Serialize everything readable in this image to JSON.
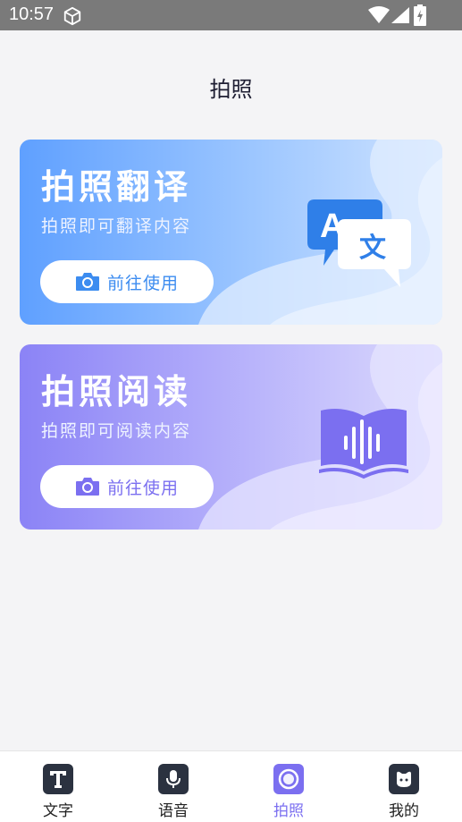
{
  "status_bar": {
    "time": "10:57"
  },
  "page": {
    "title": "拍照"
  },
  "cards": [
    {
      "title": "拍照翻译",
      "subtitle": "拍照即可翻译内容",
      "button_label": "前往使用",
      "art_glyph_a": "A",
      "art_glyph_b": "文"
    },
    {
      "title": "拍照阅读",
      "subtitle": "拍照即可阅读内容",
      "button_label": "前往使用"
    }
  ],
  "bottom_nav": {
    "items": [
      {
        "label": "文字",
        "icon": "text-icon"
      },
      {
        "label": "语音",
        "icon": "microphone-icon"
      },
      {
        "label": "拍照",
        "icon": "camera-lens-icon",
        "active": true
      },
      {
        "label": "我的",
        "icon": "profile-icon"
      }
    ]
  },
  "colors": {
    "accent_purple": "#7b6ff0",
    "accent_blue": "#3c8cf0"
  }
}
